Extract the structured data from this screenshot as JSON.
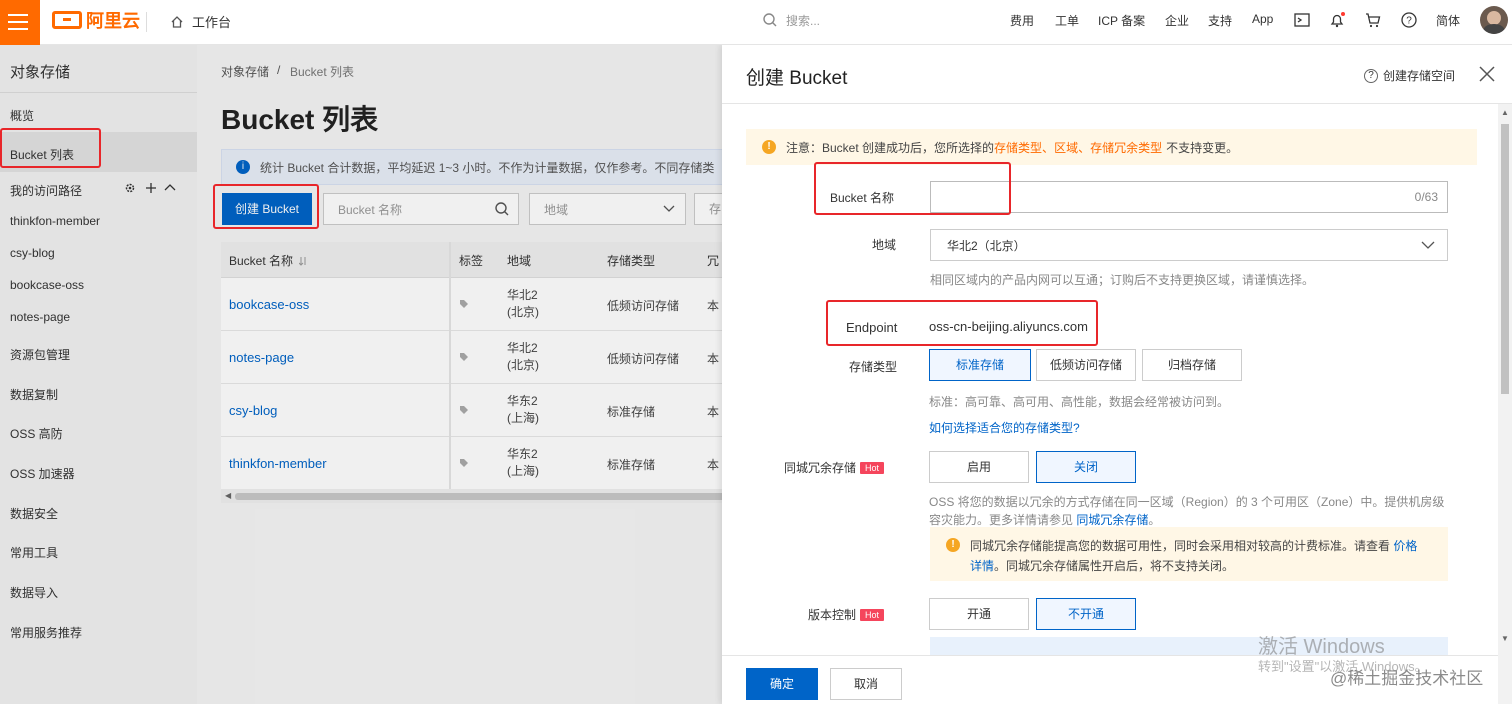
{
  "topbar": {
    "logo_text": "阿里云",
    "workbench": "工作台",
    "search_placeholder": "搜索...",
    "nav": [
      "费用",
      "工单",
      "ICP 备案",
      "企业",
      "支持",
      "App"
    ],
    "lang": "简体",
    "brand_color": "#ff6a00"
  },
  "sidebar": {
    "title": "对象存储",
    "items": [
      "概览",
      "Bucket 列表"
    ],
    "access_path": "我的访问路径",
    "paths": [
      "thinkfon-member",
      "csy-blog",
      "bookcase-oss",
      "notes-page"
    ],
    "more_items": [
      "资源包管理",
      "数据复制",
      "OSS 高防",
      "OSS 加速器",
      "数据安全",
      "常用工具",
      "数据导入",
      "常用服务推荐"
    ]
  },
  "main": {
    "breadcrumb": [
      "对象存储",
      "/",
      "Bucket 列表"
    ],
    "title": "Bucket 列表",
    "info": "统计 Bucket 合计数据，平均延迟 1~3 小时。不作为计量数据，仅作参考。不同存储类",
    "create_button": "创建 Bucket",
    "name_filter_placeholder": "Bucket 名称",
    "region_filter": "地域",
    "more_filter": "存",
    "table": {
      "headers": [
        "Bucket 名称",
        "标签",
        "地域",
        "存储类型",
        "冗"
      ],
      "rows": [
        {
          "name": "bookcase-oss",
          "region": "华北2 (北京)",
          "type": "低频访问存储",
          "more": "本"
        },
        {
          "name": "notes-page",
          "region": "华北2 (北京)",
          "type": "低频访问存储",
          "more": "本"
        },
        {
          "name": "csy-blog",
          "region": "华东2 (上海)",
          "type": "标准存储",
          "more": "本"
        },
        {
          "name": "thinkfon-member",
          "region": "华东2 (上海)",
          "type": "标准存储",
          "more": "本"
        }
      ]
    }
  },
  "drawer": {
    "title": "创建 Bucket",
    "help": "创建存储空间",
    "warning": {
      "prefix": "注意：Bucket 创建成功后，您所选择的",
      "hl1": "存储类型",
      "sep1": "、",
      "hl2": "区域",
      "sep2": "、",
      "hl3": "存储冗余类型",
      "suffix": "不支持变更。"
    },
    "name_label": "Bucket 名称",
    "name_value": "",
    "name_counter": "0/63",
    "region_label": "地域",
    "region_value": "华北2（北京）",
    "region_hint": "相同区域内的产品内网可以互通；订购后不支持更换区域，请谨慎选择。",
    "endpoint_label": "Endpoint",
    "endpoint_value": "oss-cn-beijing.aliyuncs.com",
    "storage_label": "存储类型",
    "storage_options": [
      "标准存储",
      "低频访问存储",
      "归档存储"
    ],
    "storage_selected": "标准存储",
    "storage_hint": "标准：高可靠、高可用、高性能，数据会经常被访问到。",
    "storage_link": "如何选择适合您的存储类型?",
    "redundancy_label": "同城冗余存储",
    "hot": "Hot",
    "redundancy_options": [
      "启用",
      "关闭"
    ],
    "redundancy_selected": "关闭",
    "redundancy_hint1": "OSS 将您的数据以冗余的方式存储在同一区域（Region）的 3 个可用区（Zone）中。提供机房级",
    "redundancy_hint2": "容灾能力。更多详情请参见",
    "redundancy_hint_link": "同城冗余存储",
    "redundancy_hint_end": "。",
    "redundancy_note1": "同城冗余存储能提高您的数据可用性，同时会采用相对较高的计费标准。请查看",
    "redundancy_note_link1": "价格",
    "redundancy_note_link2": "详情",
    "redundancy_note2": "。同城冗余存储属性开启后，将不支持关闭。",
    "version_label": "版本控制",
    "version_options": [
      "开通",
      "不开通"
    ],
    "version_selected": "不开通",
    "ok": "确定",
    "cancel": "取消"
  },
  "watermark": {
    "windows": "激活 Windows",
    "windows_sub": "转到\"设置\"以激活 Windows。",
    "site": "@稀土掘金技术社区"
  }
}
